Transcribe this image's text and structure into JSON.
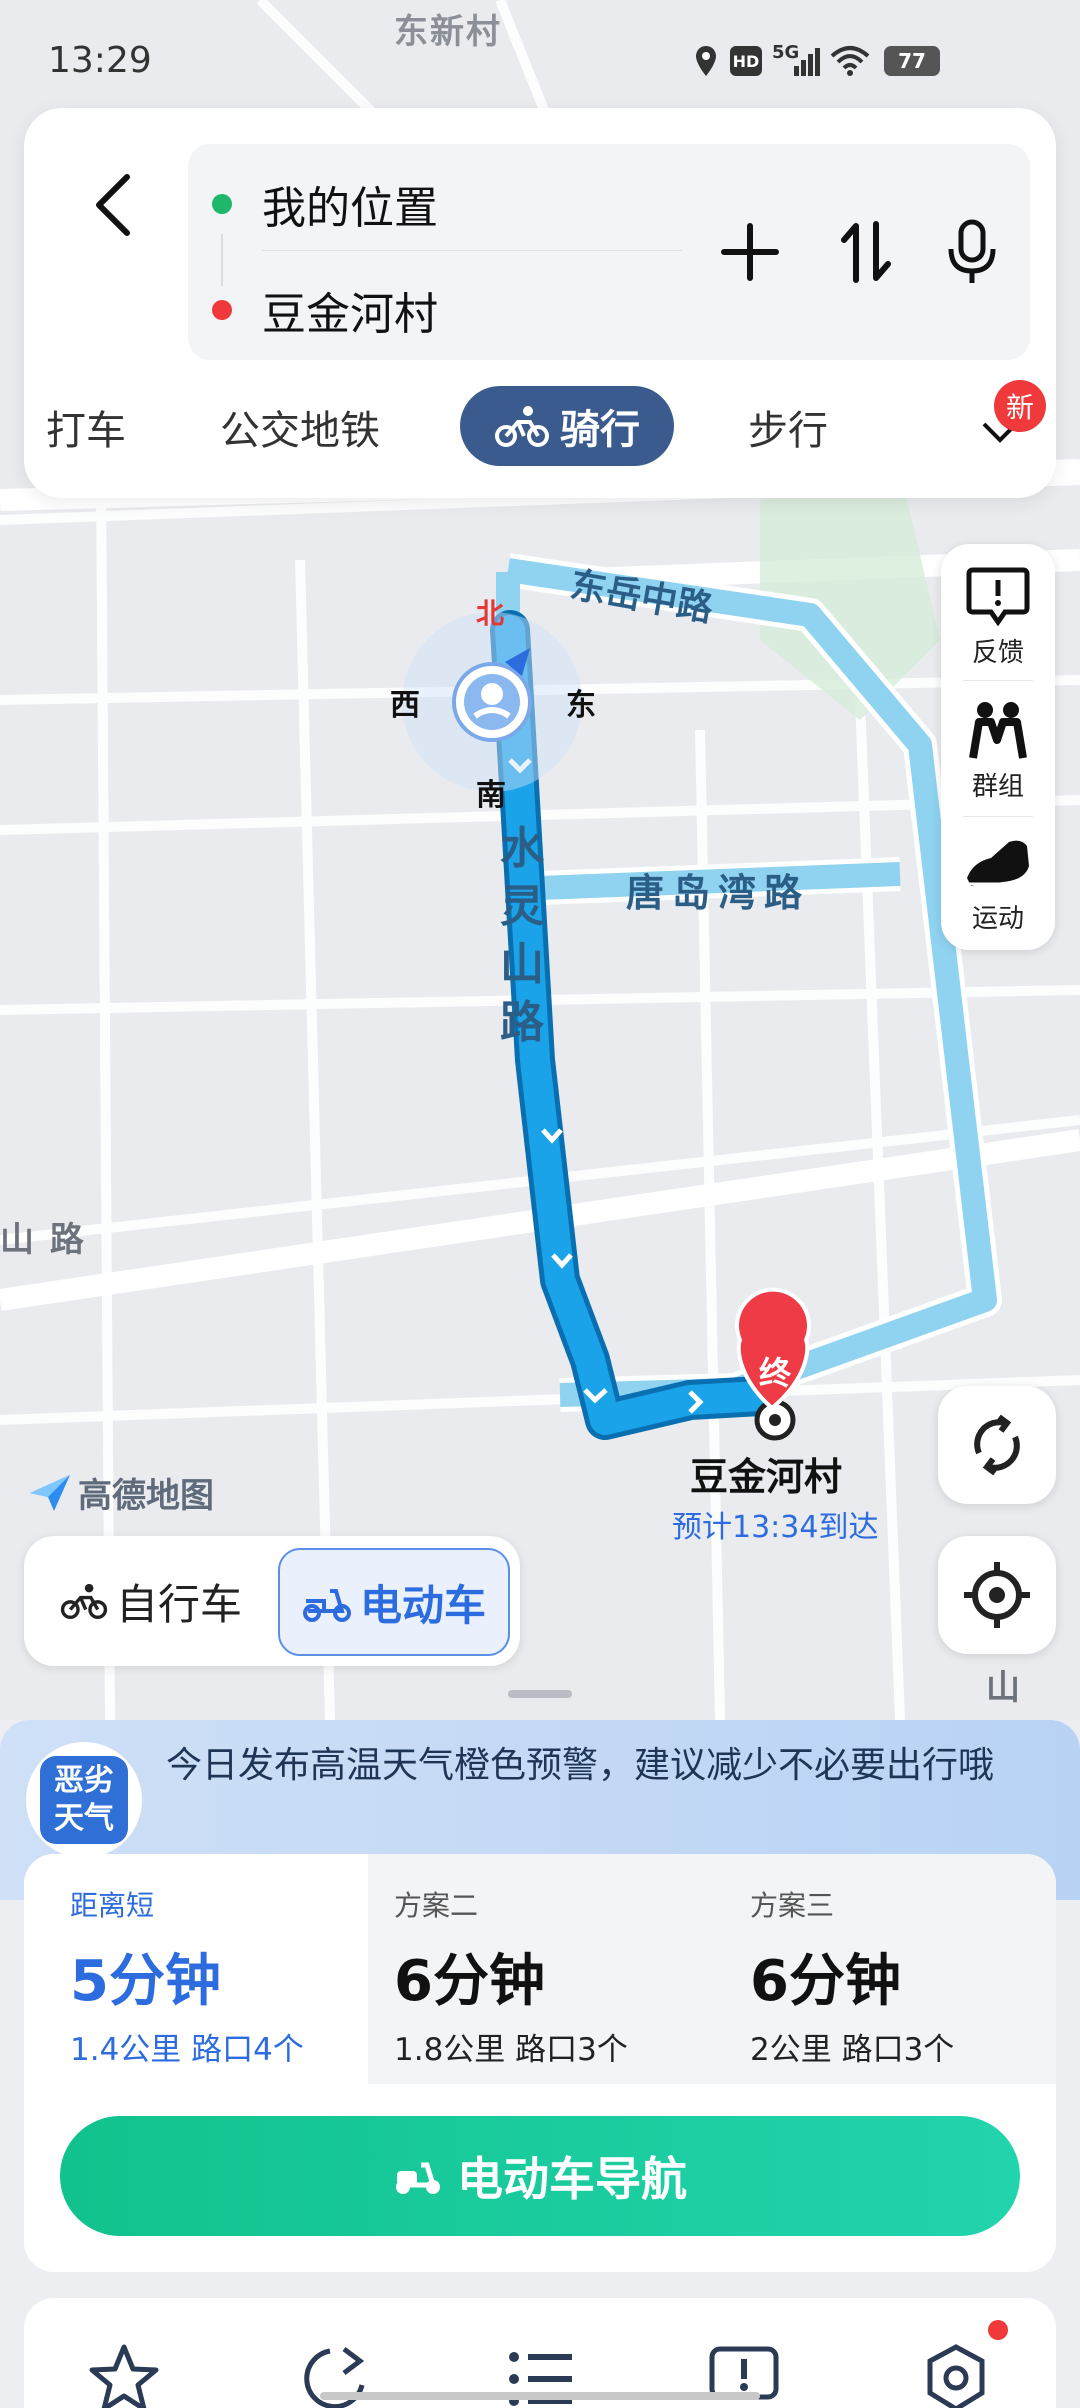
{
  "status_bar": {
    "time": "13:29",
    "network": "5G",
    "hd": "HD",
    "battery": "77"
  },
  "map": {
    "labels": {
      "village_top": "东新村",
      "road_dongyue": "东岳中路",
      "road_shuiling": "水灵山路",
      "road_tangdaowan": "唐岛湾路",
      "road_left": "山 路",
      "road_right": "山"
    },
    "compass": {
      "north": "北",
      "south": "南",
      "east": "东",
      "west": "西"
    },
    "destination": {
      "marker": "终",
      "name": "豆金河村",
      "eta": "预计13:34到达"
    },
    "logo": "高德地图"
  },
  "route_input": {
    "origin": "我的位置",
    "destination": "豆金河村",
    "origin_color": "#1fb86b",
    "destination_color": "#f0393b"
  },
  "modes": {
    "items": [
      "打车",
      "公交地铁",
      "骑行",
      "步行"
    ],
    "active": "骑行",
    "new_badge": "新"
  },
  "right_toolbar": {
    "feedback": "反馈",
    "group": "群组",
    "sport": "运动"
  },
  "vehicle": {
    "bike": "自行车",
    "ebike": "电动车",
    "selected": "电动车"
  },
  "weather": {
    "icon_line1": "恶劣",
    "icon_line2": "天气",
    "text": "今日发布高温天气橙色预警，建议减少不必要出行哦"
  },
  "plans": [
    {
      "tag": "距离短",
      "time": "5分钟",
      "meta": "1.4公里  路口4个",
      "active": true
    },
    {
      "tag": "方案二",
      "time": "6分钟",
      "meta": "1.8公里  路口3个",
      "active": false
    },
    {
      "tag": "方案三",
      "time": "6分钟",
      "meta": "2公里  路口3个",
      "active": false
    }
  ],
  "nav_button": {
    "label": "电动车导航"
  },
  "bottom_bar": {
    "icons": [
      "star-icon",
      "share-icon",
      "list-icon",
      "report-icon",
      "settings-icon"
    ]
  },
  "colors": {
    "accent": "#2d6cdf",
    "nav_green": "#12c28d",
    "route_blue": "#1aa3e8",
    "alt_route": "#8fd3f1"
  }
}
